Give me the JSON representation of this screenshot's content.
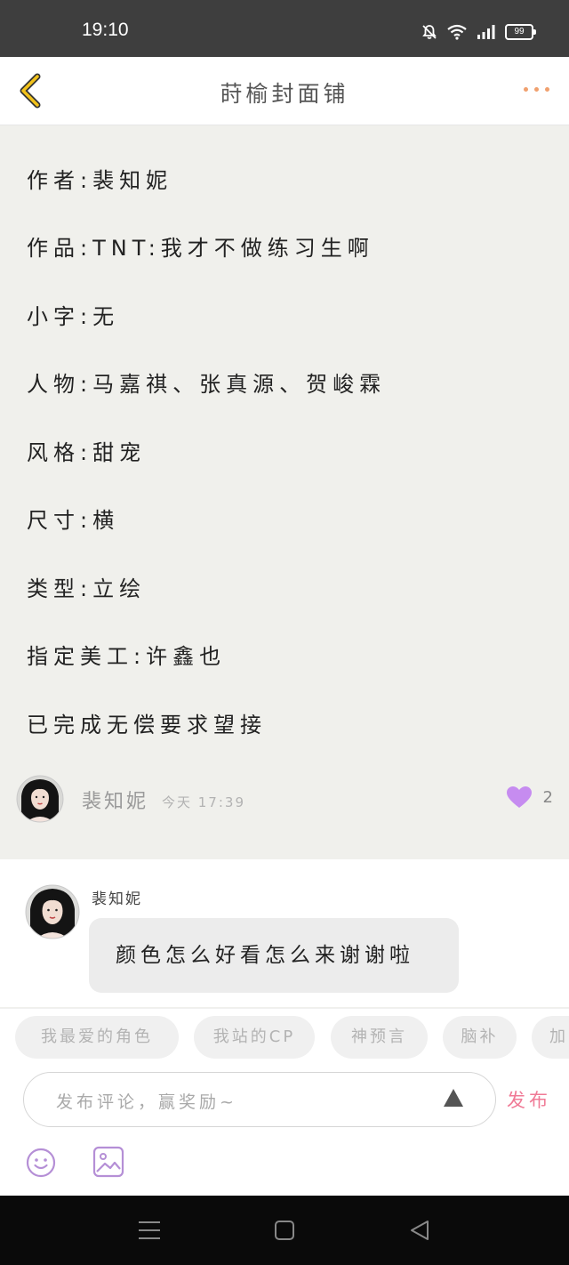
{
  "status": {
    "time": "19:10",
    "battery": "99"
  },
  "header": {
    "title": "莳榆封面铺"
  },
  "post": {
    "lines": [
      "作者:裴知妮",
      "作品:TNT:我才不做练习生啊",
      "小字:无",
      "人物:马嘉祺、张真源、贺峻霖",
      "风格:甜宠",
      "尺寸:横",
      "类型:立绘",
      "指定美工:许鑫也",
      "已完成无偿要求望接"
    ],
    "author": "裴知妮",
    "date": "今天 17:39",
    "likes": "2"
  },
  "comment": {
    "name": "裴知妮",
    "text": "颜色怎么好看怎么来谢谢啦"
  },
  "tags": [
    "我最爱的角色",
    "我站的CP",
    "神预言",
    "脑补",
    "加"
  ],
  "composer": {
    "placeholder": "发布评论，赢奖励~",
    "send": "发布"
  },
  "colors": {
    "accent": "#f07a96",
    "like": "#c68cf0",
    "back": "#f2c21b"
  },
  "icons": [
    "back-arrow-icon",
    "more-dots-icon",
    "heart-icon",
    "send-triangle-icon",
    "emoji-icon",
    "image-icon",
    "menu-icon",
    "home-square-icon",
    "back-triangle-icon"
  ]
}
